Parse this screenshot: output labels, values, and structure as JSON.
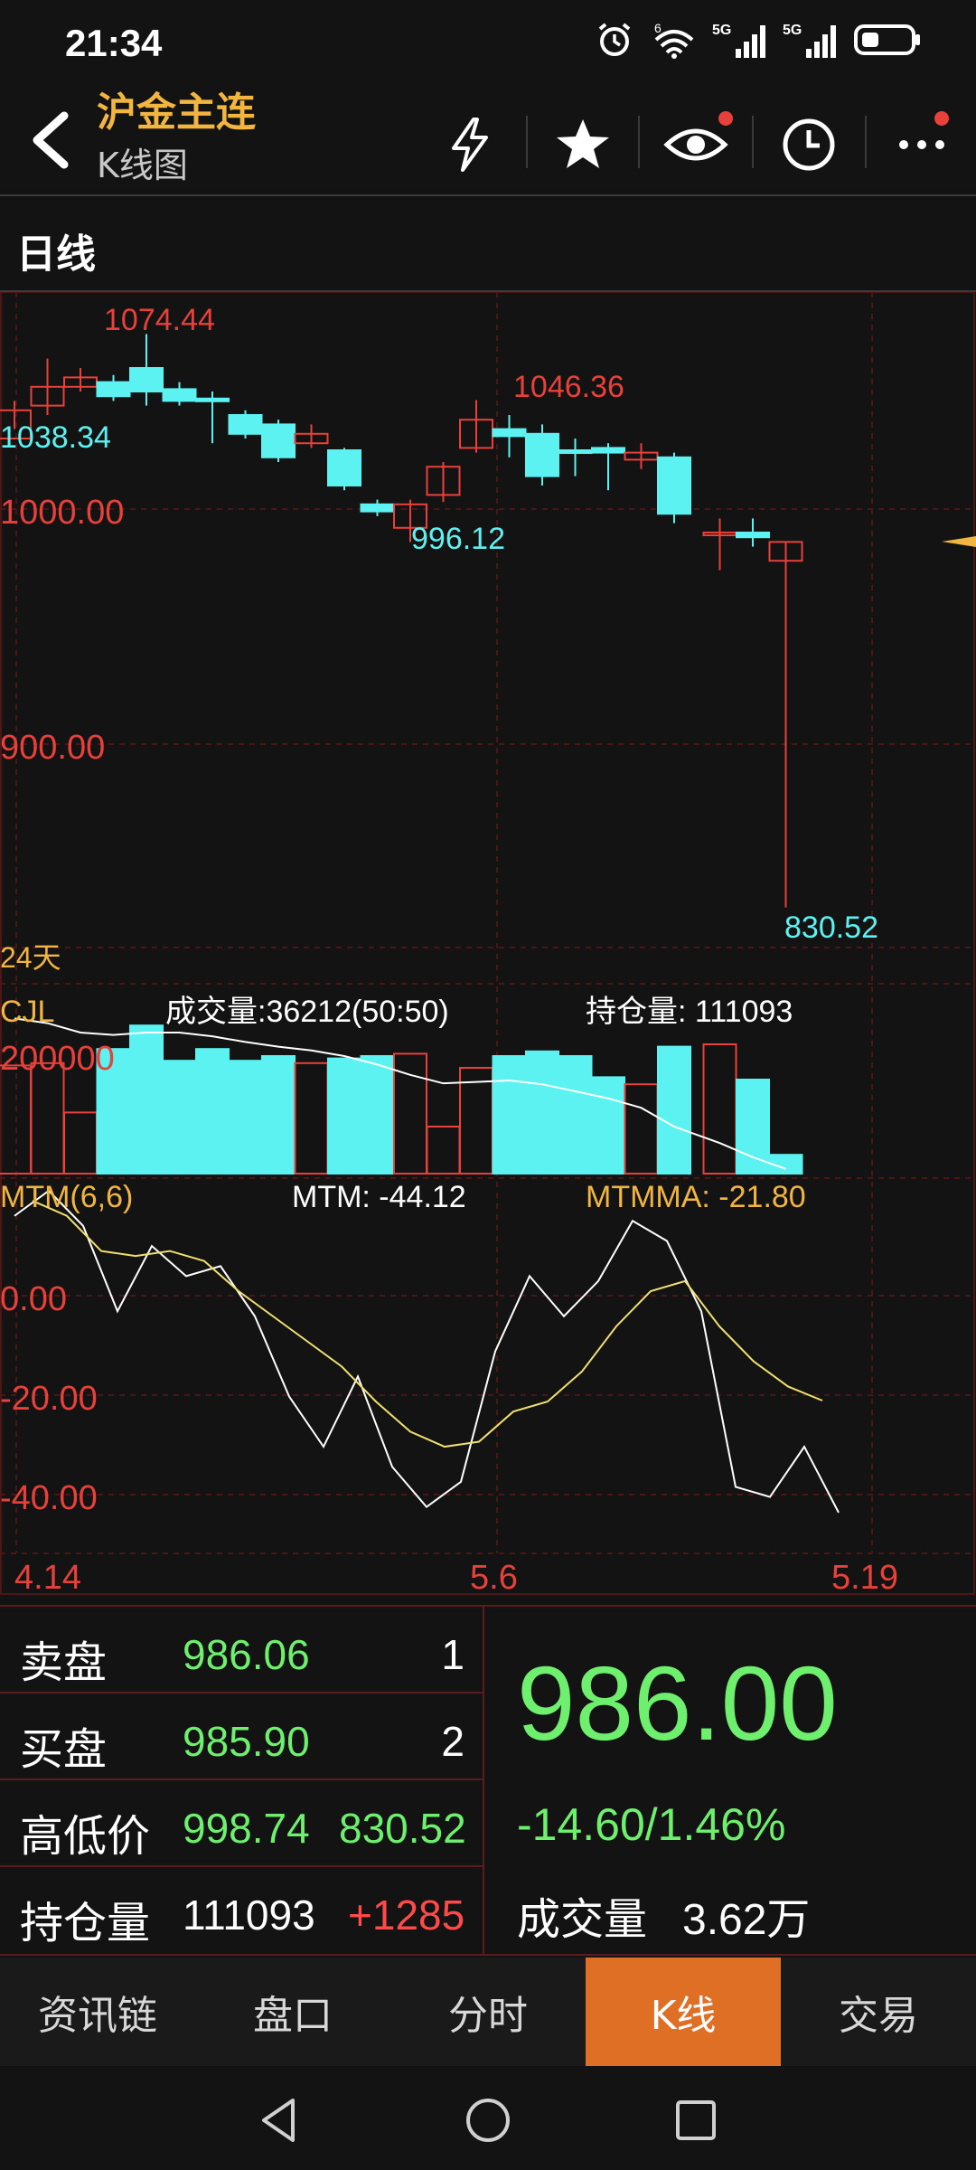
{
  "status": {
    "time": "21:34",
    "net1": "5G",
    "net2": "5G",
    "wifi_badge": "6"
  },
  "header": {
    "title": "沪金主连",
    "subtitle": "K线图"
  },
  "period": {
    "label": "日线"
  },
  "colors": {
    "up": "#e8403a",
    "down": "#5cf2f2",
    "accent": "#f2b640",
    "price_green": "#6ef06e",
    "tab_active": "#e06f26",
    "mtm_line": "#ffffff",
    "mtmma_line": "#f0e070"
  },
  "chart_data": {
    "type": "candlestick",
    "price_ticks": [
      "1000.00",
      "900.00"
    ],
    "annotations": {
      "high": "1074.44",
      "left": "1038.34",
      "mid_low": "996.12",
      "mid_high": "1046.36",
      "low": "830.52"
    },
    "days_label": "24天",
    "candles": [
      {
        "o": 1030,
        "c": 1042,
        "h": 1046,
        "l": 1034
      },
      {
        "o": 1044,
        "c": 1052,
        "h": 1064,
        "l": 1040
      },
      {
        "o": 1052,
        "c": 1056,
        "h": 1060,
        "l": 1050
      },
      {
        "o": 1054,
        "c": 1048,
        "h": 1057,
        "l": 1046
      },
      {
        "o": 1060,
        "c": 1050,
        "h": 1074.44,
        "l": 1044
      },
      {
        "o": 1051,
        "c": 1046,
        "h": 1054,
        "l": 1044
      },
      {
        "o": 1047,
        "c": 1046,
        "h": 1050,
        "l": 1028
      },
      {
        "o": 1040,
        "c": 1032,
        "h": 1042,
        "l": 1030
      },
      {
        "o": 1036,
        "c": 1022,
        "h": 1038,
        "l": 1020
      },
      {
        "o": 1028,
        "c": 1032,
        "h": 1036,
        "l": 1026
      },
      {
        "o": 1025,
        "c": 1010,
        "h": 1026,
        "l": 1008
      },
      {
        "o": 1002,
        "c": 999,
        "h": 1004,
        "l": 997
      },
      {
        "o": 992,
        "c": 1002,
        "h": 1004,
        "l": 986
      },
      {
        "o": 1006,
        "c": 1018,
        "h": 1020,
        "l": 1003
      },
      {
        "o": 1026,
        "c": 1038,
        "h": 1046.36,
        "l": 1024
      },
      {
        "o": 1034,
        "c": 1031,
        "h": 1040,
        "l": 1022
      },
      {
        "o": 1032,
        "c": 1014,
        "h": 1036,
        "l": 1010
      },
      {
        "o": 1025,
        "c": 1024,
        "h": 1030,
        "l": 1014
      },
      {
        "o": 1026,
        "c": 1024,
        "h": 1028,
        "l": 1008
      },
      {
        "o": 1021,
        "c": 1024,
        "h": 1028,
        "l": 1017
      },
      {
        "o": 1022,
        "c": 998,
        "h": 1024,
        "l": 994
      },
      {
        "o": 990,
        "c": 990,
        "h": 996,
        "l": 974
      },
      {
        "o": 990,
        "c": 988,
        "h": 996,
        "l": 984
      },
      {
        "o": 978,
        "c": 986,
        "h": 986,
        "l": 830.52
      }
    ],
    "volume_header": {
      "label": "CJL",
      "volume_text": "成交量:36212(50:50)",
      "oi_text": "持仓量: 111093"
    },
    "volume_ticks": [
      "200000"
    ],
    "volumes": [
      {
        "v": 230000,
        "up": true
      },
      {
        "v": 235000,
        "up": true
      },
      {
        "v": 130000,
        "up": true
      },
      {
        "v": 265000,
        "up": false
      },
      {
        "v": 315000,
        "up": false
      },
      {
        "v": 240000,
        "up": false
      },
      {
        "v": 265000,
        "up": false
      },
      {
        "v": 240000,
        "up": false
      },
      {
        "v": 250000,
        "up": false
      },
      {
        "v": 235000,
        "up": true
      },
      {
        "v": 245000,
        "up": false
      },
      {
        "v": 250000,
        "up": false
      },
      {
        "v": 255000,
        "up": true
      },
      {
        "v": 100000,
        "up": true
      },
      {
        "v": 225000,
        "up": true
      },
      {
        "v": 250000,
        "up": false
      },
      {
        "v": 260000,
        "up": false
      },
      {
        "v": 250000,
        "up": false
      },
      {
        "v": 205000,
        "up": false
      },
      {
        "v": 190000,
        "up": true
      },
      {
        "v": 270000,
        "up": false
      },
      {
        "v": 275000,
        "up": true
      },
      {
        "v": 200000,
        "up": false
      },
      {
        "v": 40000,
        "up": false
      }
    ],
    "volume_ma": [
      330000,
      320000,
      300000,
      295000,
      300000,
      300000,
      292000,
      280000,
      270000,
      262000,
      250000,
      232000,
      210000,
      192000,
      195000,
      198000,
      190000,
      175000,
      160000,
      140000,
      100000,
      65000,
      35000,
      10000
    ],
    "mtm_header": {
      "label": "MTM(6,6)",
      "mtm_text": "MTM: -44.12",
      "mtmma_text": "MTMMA: -21.80"
    },
    "mtm_ticks": [
      "0.00",
      "-20.00",
      "-40.00"
    ],
    "mtm": [
      15,
      20,
      13,
      -4,
      9,
      3,
      5,
      -5,
      -21,
      -31,
      -17,
      -35,
      -43,
      -38,
      -12,
      3,
      -5,
      2,
      14,
      10,
      -4,
      -39,
      -41,
      -31,
      -44.12
    ],
    "mtmma": [
      18,
      15,
      8,
      7,
      8,
      6,
      0,
      -5,
      -10,
      -15,
      -22,
      -28,
      -31,
      -30,
      -24,
      -22,
      -16,
      -7,
      0,
      2,
      -7,
      -14,
      -19,
      -21.8
    ],
    "x_labels": [
      "4.14",
      "5.6",
      "5.19"
    ]
  },
  "quote": {
    "sell_label": "卖盘",
    "sell_price": "986.06",
    "sell_qty": "1",
    "buy_label": "买盘",
    "buy_price": "985.90",
    "buy_qty": "2",
    "hilo_label": "高低价",
    "high": "998.74",
    "low": "830.52",
    "oi_label": "持仓量",
    "oi": "111093",
    "oi_change": "+1285",
    "last": "986.00",
    "change": "-14.60/1.46%",
    "vol_label": "成交量",
    "vol": "3.62万"
  },
  "tabs": [
    {
      "label": "资讯链",
      "active": false
    },
    {
      "label": "盘口",
      "active": false
    },
    {
      "label": "分时",
      "active": false
    },
    {
      "label": "K线",
      "active": true
    },
    {
      "label": "交易",
      "active": false
    }
  ]
}
